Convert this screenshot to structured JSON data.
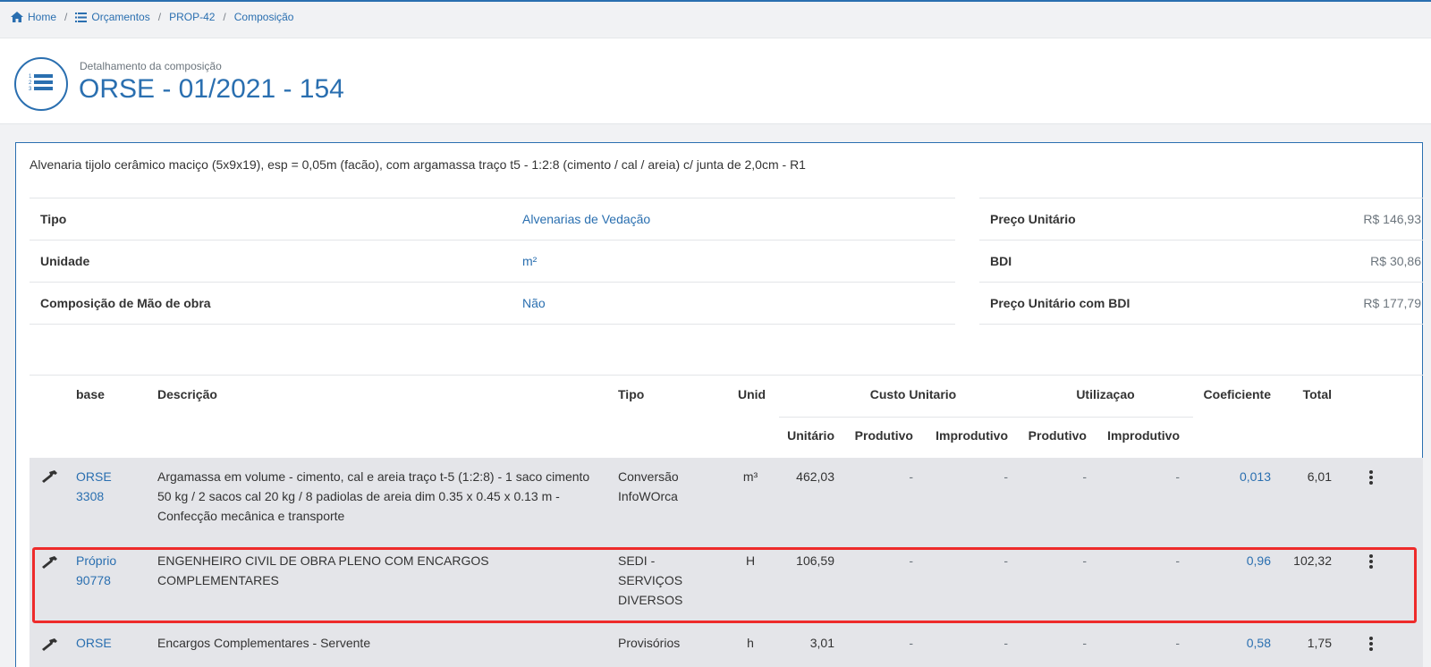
{
  "breadcrumb": {
    "home": "Home",
    "orcamentos": "Orçamentos",
    "prop": "PROP-42",
    "composicao": "Composição",
    "sep": "/"
  },
  "header": {
    "subtitle": "Detalhamento da composição",
    "title": "ORSE - 01/2021 - 154",
    "icon": "numbered-list-icon"
  },
  "composition": {
    "description": "Alvenaria tijolo cerâmico maciço (5x9x19), esp = 0,05m (facão), com argamassa traço t5 - 1:2:8 (cimento / cal / areia) c/ junta de 2,0cm - R1",
    "info_left": [
      {
        "label": "Tipo",
        "value": "Alvenarias de Vedação"
      },
      {
        "label": "Unidade",
        "value": "m²"
      },
      {
        "label": "Composição de Mão de obra",
        "value": "Não"
      }
    ],
    "info_right": [
      {
        "label": "Preço Unitário",
        "value": "R$ 146,93"
      },
      {
        "label": "BDI",
        "value": "R$ 30,86"
      },
      {
        "label": "Preço Unitário com BDI",
        "value": "R$ 177,79"
      }
    ]
  },
  "table": {
    "headers": {
      "base": "base",
      "descricao": "Descrição",
      "tipo": "Tipo",
      "unid": "Unid",
      "custo_unitario": "Custo Unitario",
      "utilizacao": "Utilizaçao",
      "coeficiente": "Coeficiente",
      "total": "Total",
      "unitario": "Unitário",
      "produtivo": "Produtivo",
      "improdutivo": "Improdutivo",
      "util_produtivo": "Produtivo",
      "util_improdutivo": "Improdutivo"
    },
    "rows": [
      {
        "base1": "ORSE",
        "base2": "3308",
        "descricao": "Argamassa em volume - cimento, cal e areia traço t-5 (1:2:8) - 1 saco cimento 50 kg / 2 sacos cal 20 kg / 8 padiolas de areia dim 0.35 x 0.45 x 0.13 m - Confecção mecânica e transporte",
        "tipo": "Conversão InfoWOrca",
        "unid": "m³",
        "unitario": "462,03",
        "produtivo": "-",
        "improdutivo": "-",
        "util_produtivo": "-",
        "util_improdutivo": "-",
        "coeficiente": "0,013",
        "total": "6,01"
      },
      {
        "base1": "Próprio",
        "base2": "90778",
        "descricao": "ENGENHEIRO CIVIL DE OBRA PLENO COM ENCARGOS COMPLEMENTARES",
        "tipo": "SEDI - SERVIÇOS DIVERSOS",
        "unid": "H",
        "unitario": "106,59",
        "produtivo": "-",
        "improdutivo": "-",
        "util_produtivo": "-",
        "util_improdutivo": "-",
        "coeficiente": "0,96",
        "total": "102,32"
      },
      {
        "base1": "ORSE",
        "base2": "",
        "descricao": "Encargos Complementares - Servente",
        "tipo": "Provisórios",
        "unid": "h",
        "unitario": "3,01",
        "produtivo": "-",
        "improdutivo": "-",
        "util_produtivo": "-",
        "util_improdutivo": "-",
        "coeficiente": "0,58",
        "total": "1,75"
      }
    ]
  },
  "colors": {
    "primary": "#2a6fb0",
    "highlight": "#ee2b2b",
    "row_bg": "#e4e5e9"
  },
  "icons": {
    "home": "home-icon",
    "list": "list-icon",
    "row": "hammer-icon",
    "menu": "kebab-menu-icon"
  }
}
